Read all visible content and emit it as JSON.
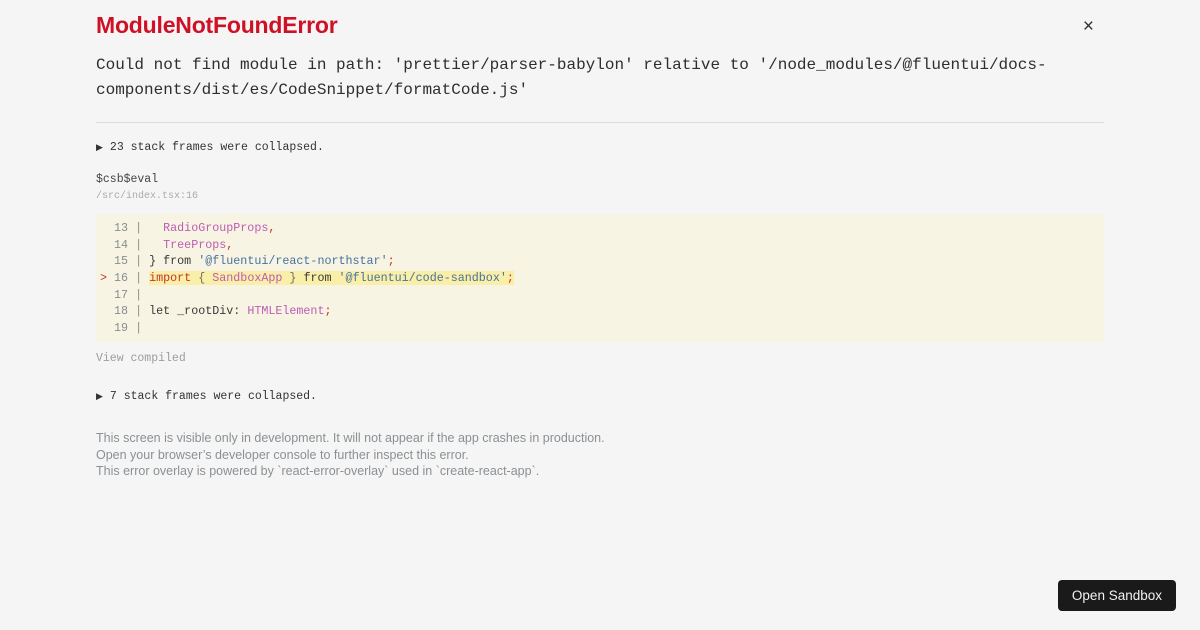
{
  "header": {
    "title": "ModuleNotFoundError",
    "close_icon": "×"
  },
  "error_message": "Could not find module in path: 'prettier/parser-babylon' relative to '/node_modules/@fluentui/docs-components/dist/es/CodeSnippet/formatCode.js'",
  "stack_top": {
    "collapse_icon": "▶",
    "label": "23 stack frames were collapsed."
  },
  "frame": {
    "function_name": "$csb$eval",
    "location": "/src/index.tsx:16"
  },
  "code_frame": {
    "lines": [
      {
        "marker": "  ",
        "num": "13",
        "pipe": " | ",
        "highlighted": false,
        "tokens": [
          {
            "text": "  ",
            "color": "plain"
          },
          {
            "text": "RadioGroupProps",
            "color": "identifier"
          },
          {
            "text": ",",
            "color": "punct"
          }
        ]
      },
      {
        "marker": "  ",
        "num": "14",
        "pipe": " | ",
        "highlighted": false,
        "tokens": [
          {
            "text": "  ",
            "color": "plain"
          },
          {
            "text": "TreeProps",
            "color": "identifier"
          },
          {
            "text": ",",
            "color": "punct"
          }
        ]
      },
      {
        "marker": "  ",
        "num": "15",
        "pipe": " | ",
        "highlighted": false,
        "tokens": [
          {
            "text": "} from ",
            "color": "plain"
          },
          {
            "text": "'@fluentui/react-northstar'",
            "color": "string"
          },
          {
            "text": ";",
            "color": "punct"
          }
        ]
      },
      {
        "marker": "> ",
        "num": "16",
        "pipe": " | ",
        "highlighted": true,
        "tokens": [
          {
            "text": "import",
            "color": "keyword"
          },
          {
            "text": " { ",
            "color": "brace"
          },
          {
            "text": "SandboxApp",
            "color": "identifier"
          },
          {
            "text": " } ",
            "color": "brace"
          },
          {
            "text": "from ",
            "color": "plain"
          },
          {
            "text": "'@fluentui/code-sandbox'",
            "color": "string"
          },
          {
            "text": ";",
            "color": "punct"
          }
        ]
      },
      {
        "marker": "  ",
        "num": "17",
        "pipe": " | ",
        "highlighted": false,
        "tokens": []
      },
      {
        "marker": "  ",
        "num": "18",
        "pipe": " | ",
        "highlighted": false,
        "tokens": [
          {
            "text": "let _rootDiv: ",
            "color": "plain"
          },
          {
            "text": "HTMLElement",
            "color": "identifier"
          },
          {
            "text": ";",
            "color": "punct"
          }
        ]
      },
      {
        "marker": "  ",
        "num": "19",
        "pipe": " | ",
        "highlighted": false,
        "tokens": []
      }
    ]
  },
  "view_compiled_label": "View compiled",
  "stack_bottom": {
    "collapse_icon": "▶",
    "label": "7 stack frames were collapsed."
  },
  "footer": {
    "lines": [
      "This screen is visible only in development. It will not appear if the app crashes in production.",
      "Open your browser’s developer console to further inspect this error.",
      "This error overlay is powered by `react-error-overlay` used in `create-react-app`."
    ]
  },
  "open_sandbox": {
    "label": "Open Sandbox"
  },
  "colors": {
    "title_red": "#ce1126",
    "marker_red": "#c5342b",
    "line_number_gray": "#878e91",
    "highlight_bg": "#faefa8",
    "code": {
      "plain": "#383838",
      "identifier": "#bc5cb4",
      "keyword": "#c5342b",
      "string": "#45719f",
      "punct": "#c5342b",
      "brace": "#6e6e60"
    }
  }
}
